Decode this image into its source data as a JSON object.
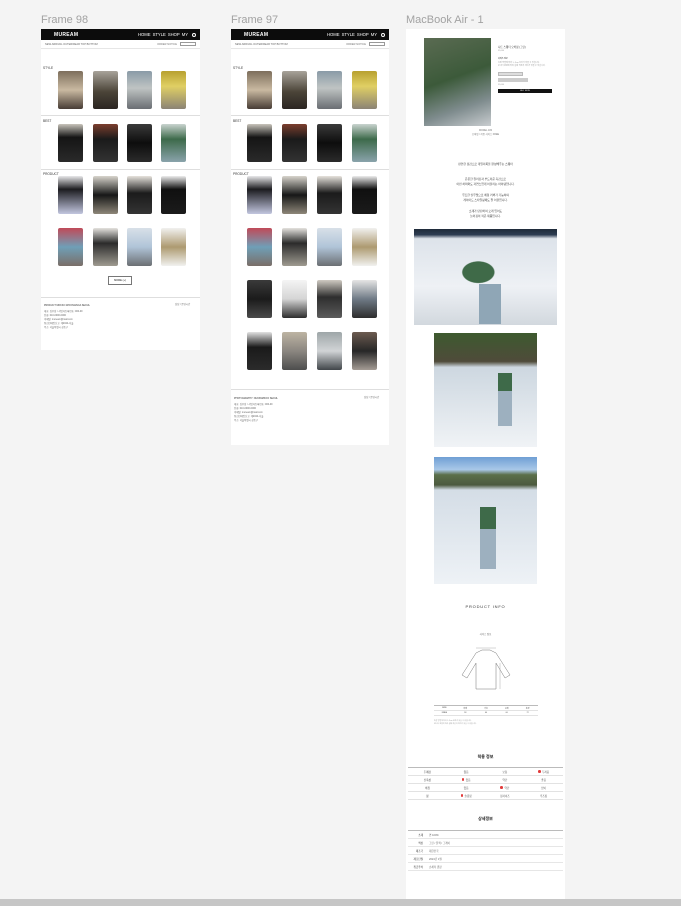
{
  "frames": {
    "f98": "Frame 98",
    "f97": "Frame 97",
    "mac": "MacBook Air - 1"
  },
  "site": {
    "logo": "MUREAM",
    "nav": [
      "HOME",
      "STYLE",
      "SHOP",
      "MY"
    ],
    "sublinks": "NEW  ARRIVAL  OUTERWEAR  TOP  BOTTOM",
    "subright": "ORDER  NOTICE",
    "sections": [
      "STYLE",
      "BEST",
      "PRODUCT"
    ],
    "more_button": "MORE (+)",
    "footer_company": "PRODUCT MOKKO WOONGINCA SEOUL",
    "footer_company_97": "PHOTOGRAPHY: NUKPAMKOO SEOUL",
    "footer_right": "상담 / 운영시간",
    "footer_lines": [
      "대표: 김무림 / 사업자등록번호: 000-00",
      "전화: 010-0000-0000",
      "이메일: muream@mail.com",
      "통신판매업신고: 제2024-서울",
      "주소: 서울특별시 성동구"
    ]
  },
  "colors": {
    "nav_bg": "#0c0c0c",
    "accent_red": "#e23b3b",
    "page_bg": "#f4f4f4"
  },
  "detail": {
    "product_title": "니트 스웨터 오버핏 (그린)",
    "price": "39,000",
    "buy_label": "BUY NOW",
    "model_info": [
      "MODEL 180",
      "오버핏 / 착용 사이즈 FREE"
    ],
    "copy_lines": [
      "편안한 핏감으로 데일리룩을 완성해주는 스웨터",
      "",
      "은은한 컬러감과 부드러운 촉감으로",
      "어떤 하의와도 자연스럽게 어울리는 아이템입니다.",
      "",
      "루즈한 실루엣으로 체형 커버가 가능하며",
      "레이어드 스타일링에도 잘 어울립니다.",
      "",
      "소재가 탄탄하여 오래 입어도",
      "늘어짐이 적은 제품입니다."
    ],
    "product_info": "PRODUCT INFO",
    "size_caption": "사이즈 정보",
    "size_headers": [
      "SIZE",
      "어깨",
      "가슴",
      "소매",
      "총장"
    ],
    "size_values": [
      "FREE",
      "58",
      "64",
      "60",
      "72"
    ],
    "size_notes": [
      "측정 방법에 따라 1~3cm 오차가 있을 수 있습니다.",
      "모니터 환경에 따라 실제 색상과 차이가 있을 수 있습니다."
    ],
    "fit_heading": "착용 정보",
    "fit_rows": [
      [
        "두께감",
        "얇음",
        "보통",
        "두꺼움"
      ],
      [
        "신축성",
        "없음",
        "약간",
        "좋음"
      ],
      [
        "비침",
        "없음",
        "약간",
        "많이"
      ],
      [
        "핏",
        "슬림핏",
        "정사이즈",
        "루즈핏"
      ]
    ],
    "fit_selected": [
      2,
      1,
      1,
      3
    ],
    "detail_heading": "상세정보",
    "detail_rows": [
      [
        "소재",
        "면 100%"
      ],
      [
        "색상",
        "그린 / 블랙 / 그레이"
      ],
      [
        "제조국",
        "대한민국"
      ],
      [
        "제조년월",
        "2024년 1월"
      ],
      [
        "취급주의",
        "손세탁 권장"
      ]
    ]
  }
}
